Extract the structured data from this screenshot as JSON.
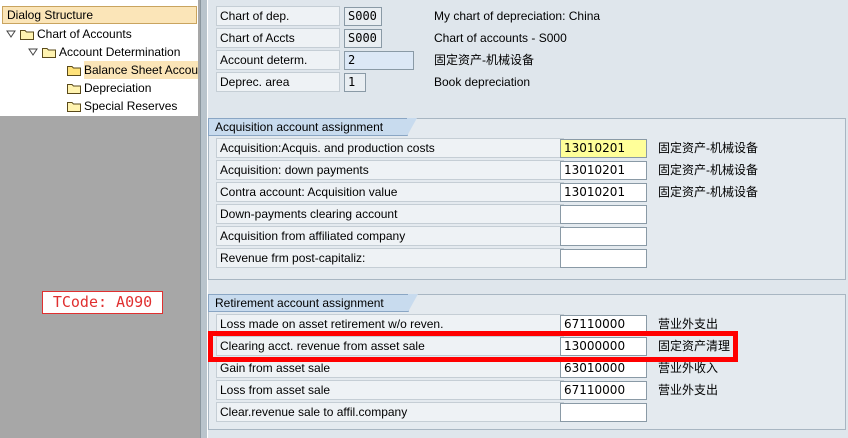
{
  "dialog_structure": {
    "header": "Dialog Structure",
    "nodes": [
      {
        "label": "Chart of Accounts",
        "expanded": true
      },
      {
        "label": "Account Determination",
        "expanded": true
      },
      {
        "label": "Balance Sheet Accou",
        "selected": true
      },
      {
        "label": "Depreciation"
      },
      {
        "label": "Special Reserves"
      }
    ]
  },
  "tcode_annotation": "TCode: A090",
  "header_fields": [
    {
      "label": "Chart of dep.",
      "value": "S000",
      "description": "My chart of depreciation: China"
    },
    {
      "label": "Chart of Accts",
      "value": "S000",
      "description": "Chart of accounts - S000"
    },
    {
      "label": "Account determ.",
      "value": "2",
      "description": "固定资产-机械设备"
    },
    {
      "label": "Deprec. area",
      "value": "1",
      "description": "Book depreciation"
    }
  ],
  "acquisition_group": {
    "title": "Acquisition account assignment",
    "rows": [
      {
        "label": "Acquisition:Acquis. and production costs",
        "value": "13010201",
        "description": "固定资产-机械设备"
      },
      {
        "label": "Acquisition: down payments",
        "value": "13010201",
        "description": "固定资产-机械设备"
      },
      {
        "label": "Contra account: Acquisition value",
        "value": "13010201",
        "description": "固定资产-机械设备"
      },
      {
        "label": "Down-payments clearing account",
        "value": "",
        "description": ""
      },
      {
        "label": "Acquisition from affiliated company",
        "value": "",
        "description": ""
      },
      {
        "label": "Revenue frm post-capitaliz:",
        "value": "",
        "description": ""
      }
    ]
  },
  "retirement_group": {
    "title": "Retirement account assignment",
    "rows": [
      {
        "label": "Loss made on asset retirement w/o reven.",
        "value": "67110000",
        "description": "营业外支出"
      },
      {
        "label": "Clearing acct. revenue from asset sale",
        "value": "13000000",
        "description": "固定资产清理"
      },
      {
        "label": "Gain from asset sale",
        "value": "63010000",
        "description": "营业外收入"
      },
      {
        "label": "Loss from asset sale",
        "value": "67110000",
        "description": "营业外支出"
      },
      {
        "label": "Clear.revenue sale to affil.company",
        "value": "",
        "description": ""
      }
    ]
  },
  "icons": {
    "tree_expanded": "triangle-down-icon",
    "tree_folder": "folder-icon",
    "search_help": "value-help-icon"
  },
  "colors": {
    "highlight_border": "#ff0000",
    "focused_field": "#ffff99",
    "tree_selected": "#fbe5b8",
    "tcode_text": "#e03030"
  }
}
